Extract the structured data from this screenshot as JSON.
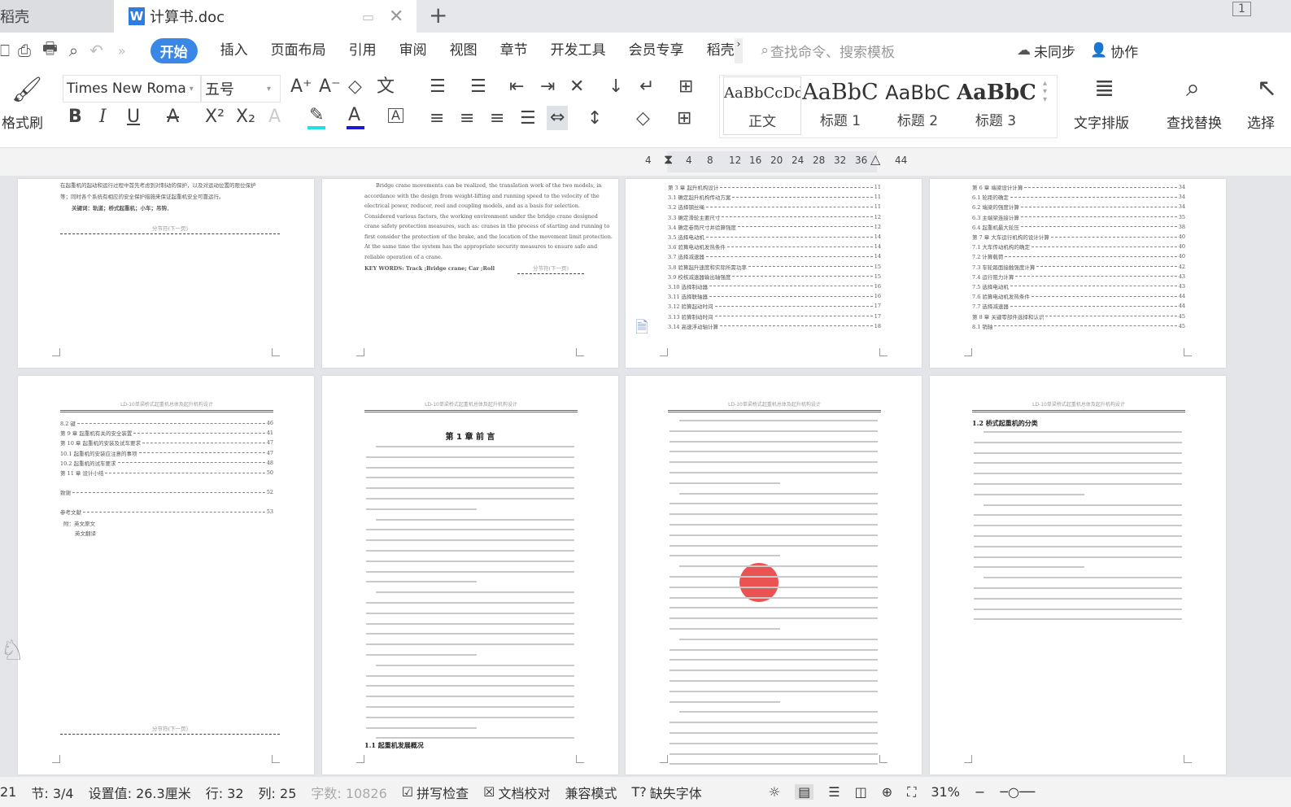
{
  "tabs": {
    "shell": "稻壳",
    "doc": "计算书.doc",
    "new_tab": "+",
    "page_indicator": "1"
  },
  "menu": {
    "items": [
      "开始",
      "插入",
      "页面布局",
      "引用",
      "审阅",
      "视图",
      "章节",
      "开发工具",
      "会员专享",
      "稻壳"
    ],
    "active": "开始",
    "search_placeholder": "查找命令、搜索模板",
    "sync": "未同步",
    "collab": "协作"
  },
  "ribbon": {
    "format_painter": "格式刷",
    "font_name": "Times New Roma",
    "font_size": "五号",
    "styles": [
      {
        "preview": "AaBbCcDd",
        "label": "正文"
      },
      {
        "preview": "AaBbC",
        "label": "标题 1"
      },
      {
        "preview": "AaBbC",
        "label": "标题 2"
      },
      {
        "preview": "AaBbC",
        "label": "标题 3"
      }
    ],
    "text_layout": "文字排版",
    "find_replace": "查找替换",
    "select": "选择",
    "highlight_color": "#22e0e8",
    "font_color": "#1a1acc"
  },
  "ruler": {
    "ticks": [
      "4",
      "4",
      "8",
      "12",
      "16",
      "20",
      "24",
      "28",
      "32",
      "36",
      "44"
    ]
  },
  "pages": {
    "p1": {
      "lines": [
        "在起重机的起动和运行过程中首先考虑到对制动的保护，以及对运动位置的限位保护",
        "等；同时各个系统有相应的安全保护措施来保证起重机安全可靠运行。"
      ],
      "keywords": "关键词：轨道；桥式起重机；小车；吊钩．",
      "section_break": "分节符(下一页)"
    },
    "p2": {
      "lines": [
        "Bridge crane movements can be realized, the translation work of the two models, in",
        "accordance with the design from weight-lifting and running speed to the velocity of the",
        "electrical power, reducer, reel and coupling models, and as a basis for selection.",
        "Considered various factors, the working environment under the bridge crane designed",
        "crane safety protection measures, such as: cranes in the process of starting and running to",
        "first consider the protection of the brake, and the location of the movement limit protection.",
        "At the same time the system has the appropriate security measures to ensure safe and",
        "reliable operation of a crane."
      ],
      "keywords": "KEY WORDS: Track ;Bridge crane; Car ;Roll",
      "section_break": "分节符(下一页)"
    },
    "p3": {
      "toc": [
        [
          "第 3 章 起升机构设计",
          "11"
        ],
        [
          "3.1 确定起升机构传动方案",
          "11"
        ],
        [
          "3.2 选择钢丝绳",
          "11"
        ],
        [
          "3.3 确定滑轮主要尺寸",
          "12"
        ],
        [
          "3.4 确定卷筒尺寸并验算强度",
          "12"
        ],
        [
          "3.5 选择电动机",
          "14"
        ],
        [
          "3.6 验算电动机发热条件",
          "14"
        ],
        [
          "3.7 选择减速器",
          "14"
        ],
        [
          "3.8 验算起升速度和实际所需功率",
          "15"
        ],
        [
          "3.9 校核减速器输出轴强度",
          "15"
        ],
        [
          "3.10 选择制动器",
          "16"
        ],
        [
          "3.11 选择联轴器",
          "16"
        ],
        [
          "3.12 验算起动时间",
          "17"
        ],
        [
          "3.13 验算制动时间",
          "17"
        ],
        [
          "3.14 高速浮动轴计算",
          "18"
        ]
      ]
    },
    "p4": {
      "toc": [
        [
          "第 6 章 端梁设计计算",
          "34"
        ],
        [
          "6.1 轮距的确定",
          "34"
        ],
        [
          "6.2 端梁的强度计算",
          "34"
        ],
        [
          "6.3 主端梁连接计算",
          "35"
        ],
        [
          "6.4 起重机最大轮压",
          "38"
        ],
        [
          "第 7 章 大车运行机构的设计计算",
          "40"
        ],
        [
          "7.1 大车传动机构的确定",
          "40"
        ],
        [
          "7.2 计算载荷",
          "40"
        ],
        [
          "7.3 车轮踏面接触强度计算",
          "42"
        ],
        [
          "7.4 运行阻力计算",
          "43"
        ],
        [
          "7.5 选择电动机",
          "43"
        ],
        [
          "7.6 验算电动机发热条件",
          "44"
        ],
        [
          "7.7 选择减速器",
          "44"
        ],
        [
          "第 8 章 关键零部件选择和认识",
          "45"
        ],
        [
          "8.1 销轴",
          "45"
        ]
      ]
    },
    "header": "LD-10单梁桥式起重机总体及起升机构设计",
    "p5": {
      "toc": [
        [
          "8.2 键",
          "46"
        ],
        [
          "第 9 章 起重机有关的安全装置",
          "41"
        ],
        [
          "第 10 章 起重机的安装及试车要求",
          "47"
        ],
        [
          "10.1 起重机的安装应注意的事项",
          "47"
        ],
        [
          "10.2 起重机的试车要求",
          "48"
        ],
        [
          "第 11 章 设计小结",
          "50"
        ],
        [
          "致谢",
          "52"
        ],
        [
          "参考文献",
          "53"
        ]
      ],
      "appendix": [
        "附：英文原文",
        "英文翻译"
      ],
      "section_break": "分节符(下一页)"
    },
    "p6": {
      "chapter": "第 1 章  前  言",
      "subsection": "1.1 起重机发展概况"
    },
    "p8": {
      "subsection": "1.2 桥式起重机的分类"
    }
  },
  "status": {
    "page": "21",
    "section": "节: 3/4",
    "setting": "设置值: 26.3厘米",
    "row": "行: 32",
    "col": "列: 25",
    "word_count": "字数: 10826",
    "spell_check": "拼写检查",
    "proofread": "文档校对",
    "compat": "兼容模式",
    "missing_font": "缺失字体",
    "zoom": "31%"
  }
}
